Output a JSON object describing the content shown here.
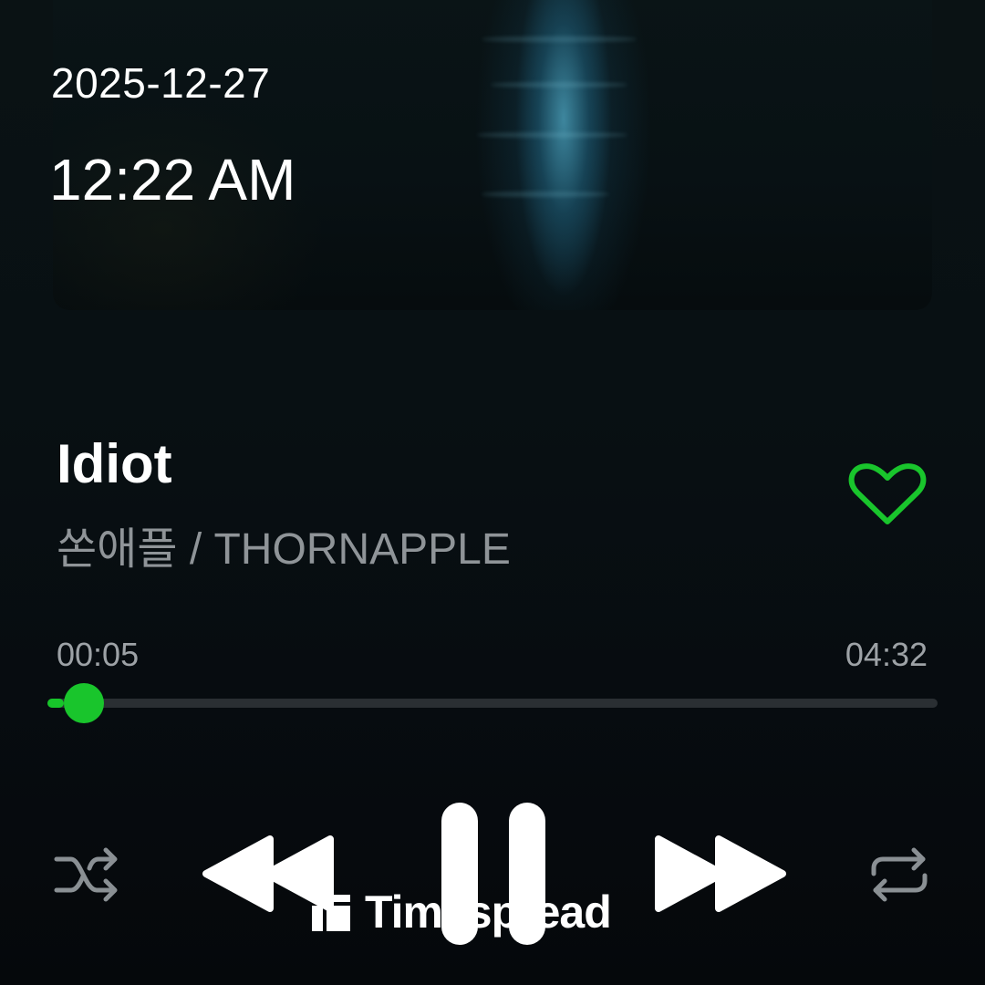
{
  "overlay": {
    "date": "2025-12-27",
    "time": "12:22 AM"
  },
  "track": {
    "title": "Idiot",
    "artist": "쏜애플 / THORNAPPLE",
    "liked": true
  },
  "progress": {
    "elapsed": "00:05",
    "total": "04:32",
    "fraction": 0.018
  },
  "controls": {
    "shuffle_icon": "shuffle-icon",
    "previous_icon": "rewind-icon",
    "pause_icon": "pause-icon",
    "next_icon": "fast-forward-icon",
    "repeat_icon": "repeat-icon"
  },
  "watermark": {
    "text": "Timespread"
  },
  "colors": {
    "accent": "#19c52c",
    "background": "#070b0e",
    "secondary_text": "#8f9498"
  }
}
